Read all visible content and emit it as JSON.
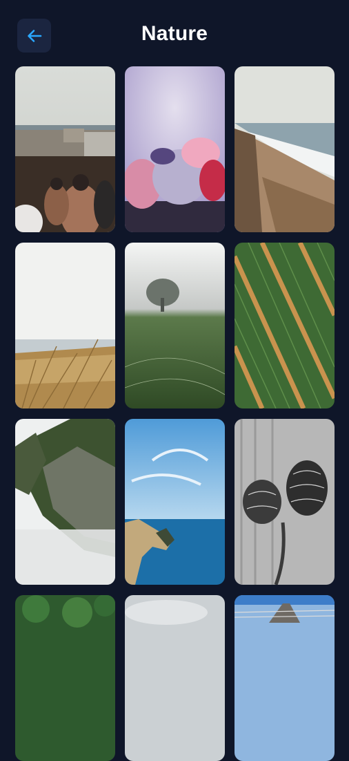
{
  "header": {
    "title": "Nature",
    "back_icon": "arrow-left-icon",
    "accent": "#2aa8ff"
  },
  "wallpapers": [
    {
      "subject": "crowd-beach-town"
    },
    {
      "subject": "frozen-berries"
    },
    {
      "subject": "coastal-cliff"
    },
    {
      "subject": "dune-grass-sea"
    },
    {
      "subject": "foggy-field-tree"
    },
    {
      "subject": "crop-rows-aerial"
    },
    {
      "subject": "misty-cliff"
    },
    {
      "subject": "blue-sky-coast"
    },
    {
      "subject": "pine-cones-bw"
    },
    {
      "subject": "green-foliage"
    },
    {
      "subject": "cloudy-sky"
    },
    {
      "subject": "pier-railway"
    }
  ]
}
